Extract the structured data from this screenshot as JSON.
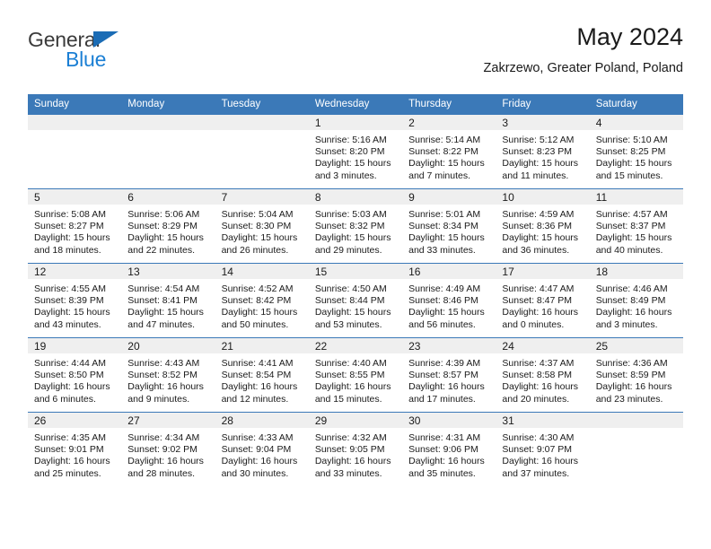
{
  "brand": {
    "name_part1": "General",
    "name_part2": "Blue",
    "triangle_color": "#1b6cb5",
    "blue_color": "#1b7fd4"
  },
  "header": {
    "title": "May 2024",
    "subtitle": "Zakrzewo, Greater Poland, Poland"
  },
  "theme": {
    "header_blue": "#3b79b8",
    "daynum_band": "#efefef",
    "text": "#1a1a1a"
  },
  "calendar": {
    "weekday_headers": [
      "Sunday",
      "Monday",
      "Tuesday",
      "Wednesday",
      "Thursday",
      "Friday",
      "Saturday"
    ],
    "labels": {
      "sunrise": "Sunrise:",
      "sunset": "Sunset:",
      "daylight": "Daylight:"
    },
    "weeks": [
      [
        {
          "day": "",
          "sunrise": "",
          "sunset": "",
          "daylight": ""
        },
        {
          "day": "",
          "sunrise": "",
          "sunset": "",
          "daylight": ""
        },
        {
          "day": "",
          "sunrise": "",
          "sunset": "",
          "daylight": ""
        },
        {
          "day": "1",
          "sunrise": "Sunrise: 5:16 AM",
          "sunset": "Sunset: 8:20 PM",
          "daylight": "Daylight: 15 hours and 3 minutes."
        },
        {
          "day": "2",
          "sunrise": "Sunrise: 5:14 AM",
          "sunset": "Sunset: 8:22 PM",
          "daylight": "Daylight: 15 hours and 7 minutes."
        },
        {
          "day": "3",
          "sunrise": "Sunrise: 5:12 AM",
          "sunset": "Sunset: 8:23 PM",
          "daylight": "Daylight: 15 hours and 11 minutes."
        },
        {
          "day": "4",
          "sunrise": "Sunrise: 5:10 AM",
          "sunset": "Sunset: 8:25 PM",
          "daylight": "Daylight: 15 hours and 15 minutes."
        }
      ],
      [
        {
          "day": "5",
          "sunrise": "Sunrise: 5:08 AM",
          "sunset": "Sunset: 8:27 PM",
          "daylight": "Daylight: 15 hours and 18 minutes."
        },
        {
          "day": "6",
          "sunrise": "Sunrise: 5:06 AM",
          "sunset": "Sunset: 8:29 PM",
          "daylight": "Daylight: 15 hours and 22 minutes."
        },
        {
          "day": "7",
          "sunrise": "Sunrise: 5:04 AM",
          "sunset": "Sunset: 8:30 PM",
          "daylight": "Daylight: 15 hours and 26 minutes."
        },
        {
          "day": "8",
          "sunrise": "Sunrise: 5:03 AM",
          "sunset": "Sunset: 8:32 PM",
          "daylight": "Daylight: 15 hours and 29 minutes."
        },
        {
          "day": "9",
          "sunrise": "Sunrise: 5:01 AM",
          "sunset": "Sunset: 8:34 PM",
          "daylight": "Daylight: 15 hours and 33 minutes."
        },
        {
          "day": "10",
          "sunrise": "Sunrise: 4:59 AM",
          "sunset": "Sunset: 8:36 PM",
          "daylight": "Daylight: 15 hours and 36 minutes."
        },
        {
          "day": "11",
          "sunrise": "Sunrise: 4:57 AM",
          "sunset": "Sunset: 8:37 PM",
          "daylight": "Daylight: 15 hours and 40 minutes."
        }
      ],
      [
        {
          "day": "12",
          "sunrise": "Sunrise: 4:55 AM",
          "sunset": "Sunset: 8:39 PM",
          "daylight": "Daylight: 15 hours and 43 minutes."
        },
        {
          "day": "13",
          "sunrise": "Sunrise: 4:54 AM",
          "sunset": "Sunset: 8:41 PM",
          "daylight": "Daylight: 15 hours and 47 minutes."
        },
        {
          "day": "14",
          "sunrise": "Sunrise: 4:52 AM",
          "sunset": "Sunset: 8:42 PM",
          "daylight": "Daylight: 15 hours and 50 minutes."
        },
        {
          "day": "15",
          "sunrise": "Sunrise: 4:50 AM",
          "sunset": "Sunset: 8:44 PM",
          "daylight": "Daylight: 15 hours and 53 minutes."
        },
        {
          "day": "16",
          "sunrise": "Sunrise: 4:49 AM",
          "sunset": "Sunset: 8:46 PM",
          "daylight": "Daylight: 15 hours and 56 minutes."
        },
        {
          "day": "17",
          "sunrise": "Sunrise: 4:47 AM",
          "sunset": "Sunset: 8:47 PM",
          "daylight": "Daylight: 16 hours and 0 minutes."
        },
        {
          "day": "18",
          "sunrise": "Sunrise: 4:46 AM",
          "sunset": "Sunset: 8:49 PM",
          "daylight": "Daylight: 16 hours and 3 minutes."
        }
      ],
      [
        {
          "day": "19",
          "sunrise": "Sunrise: 4:44 AM",
          "sunset": "Sunset: 8:50 PM",
          "daylight": "Daylight: 16 hours and 6 minutes."
        },
        {
          "day": "20",
          "sunrise": "Sunrise: 4:43 AM",
          "sunset": "Sunset: 8:52 PM",
          "daylight": "Daylight: 16 hours and 9 minutes."
        },
        {
          "day": "21",
          "sunrise": "Sunrise: 4:41 AM",
          "sunset": "Sunset: 8:54 PM",
          "daylight": "Daylight: 16 hours and 12 minutes."
        },
        {
          "day": "22",
          "sunrise": "Sunrise: 4:40 AM",
          "sunset": "Sunset: 8:55 PM",
          "daylight": "Daylight: 16 hours and 15 minutes."
        },
        {
          "day": "23",
          "sunrise": "Sunrise: 4:39 AM",
          "sunset": "Sunset: 8:57 PM",
          "daylight": "Daylight: 16 hours and 17 minutes."
        },
        {
          "day": "24",
          "sunrise": "Sunrise: 4:37 AM",
          "sunset": "Sunset: 8:58 PM",
          "daylight": "Daylight: 16 hours and 20 minutes."
        },
        {
          "day": "25",
          "sunrise": "Sunrise: 4:36 AM",
          "sunset": "Sunset: 8:59 PM",
          "daylight": "Daylight: 16 hours and 23 minutes."
        }
      ],
      [
        {
          "day": "26",
          "sunrise": "Sunrise: 4:35 AM",
          "sunset": "Sunset: 9:01 PM",
          "daylight": "Daylight: 16 hours and 25 minutes."
        },
        {
          "day": "27",
          "sunrise": "Sunrise: 4:34 AM",
          "sunset": "Sunset: 9:02 PM",
          "daylight": "Daylight: 16 hours and 28 minutes."
        },
        {
          "day": "28",
          "sunrise": "Sunrise: 4:33 AM",
          "sunset": "Sunset: 9:04 PM",
          "daylight": "Daylight: 16 hours and 30 minutes."
        },
        {
          "day": "29",
          "sunrise": "Sunrise: 4:32 AM",
          "sunset": "Sunset: 9:05 PM",
          "daylight": "Daylight: 16 hours and 33 minutes."
        },
        {
          "day": "30",
          "sunrise": "Sunrise: 4:31 AM",
          "sunset": "Sunset: 9:06 PM",
          "daylight": "Daylight: 16 hours and 35 minutes."
        },
        {
          "day": "31",
          "sunrise": "Sunrise: 4:30 AM",
          "sunset": "Sunset: 9:07 PM",
          "daylight": "Daylight: 16 hours and 37 minutes."
        },
        {
          "day": "",
          "sunrise": "",
          "sunset": "",
          "daylight": ""
        }
      ]
    ]
  }
}
